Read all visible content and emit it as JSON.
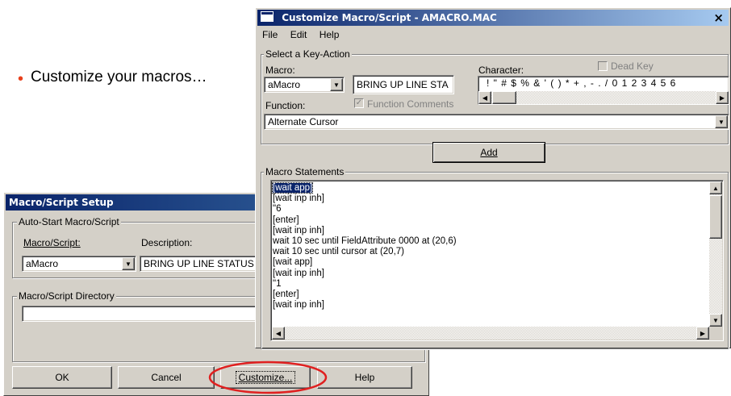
{
  "bullet_text": "Customize your macros…",
  "colors": {
    "bullet": "#e8401c",
    "highlight_ellipse": "#e02020",
    "title_active": "#0a246a"
  },
  "setup_dialog": {
    "title": "Macro/Script Setup",
    "autostart_group": "Auto-Start Macro/Script",
    "macro_script_label": "Macro/Script:",
    "description_label": "Description:",
    "macro_value": "aMacro",
    "description_value": "BRING UP LINE STATUS",
    "directory_group": "Macro/Script Directory",
    "directory_value": "",
    "buttons": {
      "ok": "OK",
      "cancel": "Cancel",
      "customize": "Customize...",
      "help": "Help"
    }
  },
  "customize_dialog": {
    "title": "Customize Macro/Script - AMACRO.MAC",
    "close": "×",
    "menu": {
      "file": "File",
      "edit": "Edit",
      "help": "Help"
    },
    "select_group": "Select a Key-Action",
    "macro_label": "Macro:",
    "macro_value": "aMacro",
    "macro_desc": "BRING UP LINE STA",
    "character_label": "Character:",
    "dead_key_label": "Dead Key",
    "characters": "! \" # $ % & ' ( ) * + , - . / 0 1 2 3 4 5 6",
    "function_label": "Function:",
    "function_comments_label": "Function Comments",
    "function_value": "Alternate Cursor",
    "add_button": "Add",
    "statements_group": "Macro Statements",
    "statements": [
      "[wait app]",
      "[wait inp inh]",
      "\"6",
      "[enter]",
      "[wait inp inh]",
      "wait 10 sec until FieldAttribute 0000 at (20,6)",
      "wait 10 sec until cursor at (20,7)",
      "[wait app]",
      "[wait inp inh]",
      "\"1",
      "[enter]",
      "[wait inp inh]"
    ]
  }
}
